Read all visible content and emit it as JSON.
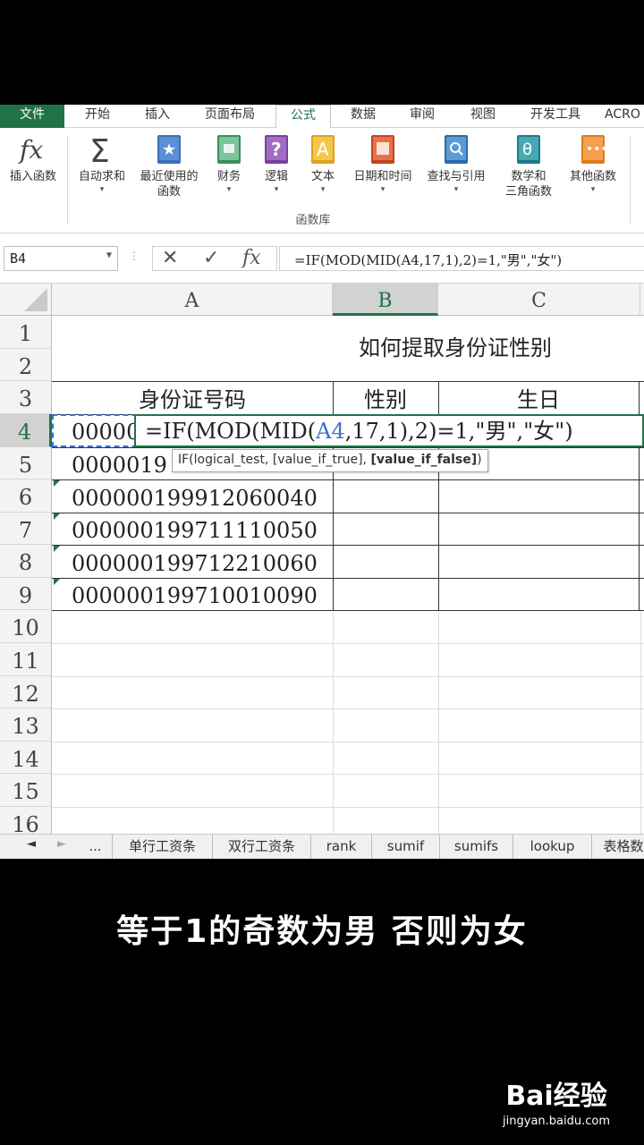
{
  "ribbon_tabs": [
    "文件",
    "开始",
    "插入",
    "页面布局",
    "公式",
    "数据",
    "审阅",
    "视图",
    "开发工具",
    "ACRO"
  ],
  "ribbon_buttons": [
    {
      "label": "插入函数",
      "label2": "",
      "icon": "fx-icon"
    },
    {
      "label": "自动求和",
      "label2": "",
      "icon": "sigma-icon"
    },
    {
      "label": "最近使用的",
      "label2": "函数",
      "icon": "star-book-icon"
    },
    {
      "label": "财务",
      "label2": "",
      "icon": "finance-book-icon"
    },
    {
      "label": "逻辑",
      "label2": "",
      "icon": "question-book-icon"
    },
    {
      "label": "文本",
      "label2": "",
      "icon": "text-book-icon"
    },
    {
      "label": "日期和时间",
      "label2": "",
      "icon": "calendar-book-icon"
    },
    {
      "label": "查找与引用",
      "label2": "",
      "icon": "search-book-icon"
    },
    {
      "label": "数学和",
      "label2": "三角函数",
      "icon": "theta-book-icon"
    },
    {
      "label": "其他函数",
      "label2": "",
      "icon": "more-book-icon"
    }
  ],
  "ribbon_group_label": "函数库",
  "formula_bar": {
    "name_box": "B4",
    "formula": "=IF(MOD(MID(A4,17,1),2)=1,\"男\",\"女\")"
  },
  "columns": [
    "A",
    "B",
    "C"
  ],
  "rows": [
    "1",
    "2",
    "3",
    "4",
    "5",
    "6",
    "7",
    "8",
    "9",
    "10",
    "11",
    "12",
    "13",
    "14",
    "15",
    "16"
  ],
  "sheet": {
    "title": "如何提取身份证性别",
    "headers": {
      "id": "身份证号码",
      "gender": "性别",
      "birthday": "生日"
    },
    "ids": [
      "0000019",
      "000000199912060040",
      "000000199711110050",
      "000000199712210060",
      "000000199710010090"
    ],
    "a4_partial": "00000"
  },
  "edit": {
    "prefix": "=IF(MOD(MID(",
    "ref": "A4",
    "suffix": ",17,1),2)=1,\"男\",\"女\")"
  },
  "tooltip": {
    "text": "IF(logical_test, [value_if_true], ",
    "bold": "[value_if_false]",
    "end": ")"
  },
  "sheet_tabs": [
    "...",
    "单行工资条",
    "双行工资条",
    "rank",
    "sumif",
    "sumifs",
    "lookup",
    "表格数"
  ],
  "caption": "等于1的奇数为男 否则为女",
  "watermark": {
    "logo": "Bai经验",
    "url": "jingyan.baidu.com"
  },
  "colors": {
    "accent": "#217346",
    "ref_blue": "#3b6fd1"
  }
}
